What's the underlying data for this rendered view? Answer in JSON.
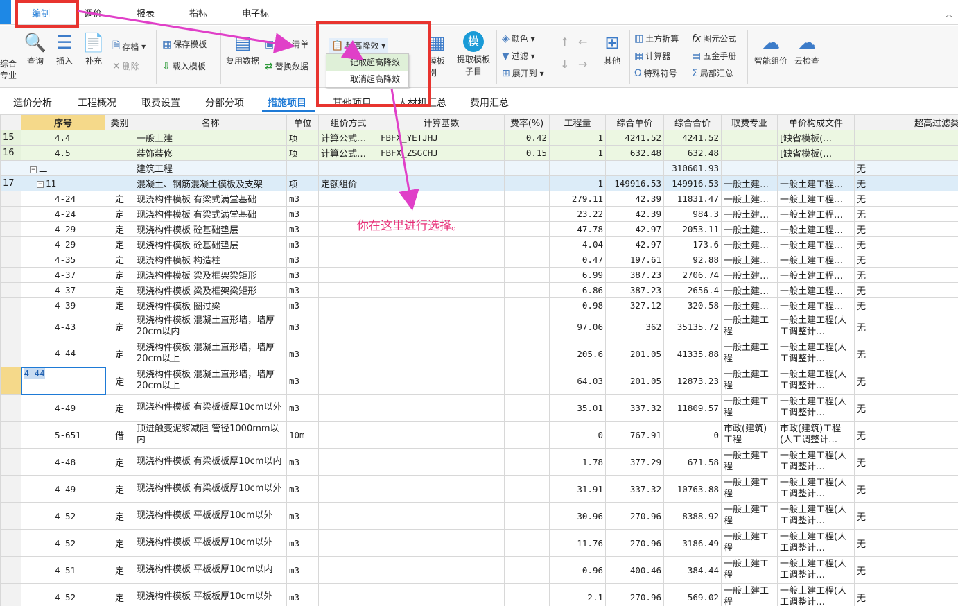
{
  "menu": {
    "items": [
      "编制",
      "调价",
      "报表",
      "指标",
      "电子标"
    ]
  },
  "ribbon": {
    "left_clip_top": "综合",
    "left_clip_bottom": "专业",
    "query": "查询",
    "insert": "插入",
    "supplement": "补充",
    "save": "存档",
    "delete": "删除",
    "save_template": "保存模板",
    "load_template": "载入模板",
    "reuse_data": "复用数据",
    "bill": "清单",
    "replace_data": "替换数据",
    "super_high": "超高降效",
    "template_clip": "模板",
    "template_clip2": "别",
    "extract_template": "提取模板",
    "extract_template2": "子目",
    "template_icon_char": "模",
    "color": "颜色",
    "filter": "过滤",
    "expand": "展开到",
    "other": "其他",
    "earthwork": "土方折算",
    "calculator": "计算器",
    "special_symbol": "特殊符号",
    "element_formula": "图元公式",
    "hardware_manual": "五金手册",
    "partial_summary": "局部汇总",
    "smart_pricing": "智能组价",
    "cloud_check": "云检查"
  },
  "dropdown": {
    "items": [
      "记取超高降效",
      "取消超高降效"
    ]
  },
  "tabs": [
    "造价分析",
    "工程概况",
    "取费设置",
    "分部分项",
    "措施项目",
    "其他项目",
    "人材机汇总",
    "费用汇总"
  ],
  "columns": [
    "序号",
    "类别",
    "名称",
    "单位",
    "组价方式",
    "计算基数",
    "费率(%)",
    "工程量",
    "综合单价",
    "综合合价",
    "取费专业",
    "单价构成文件",
    "超高过滤类别"
  ],
  "rows": [
    {
      "rn": "15",
      "seq": "4.4",
      "type": "",
      "name": "一般土建",
      "unit": "项",
      "method": "计算公式…",
      "base": "FBFX_YETJHJ",
      "rate": "0.42",
      "qty": "1",
      "price": "4241.52",
      "total": "4241.52",
      "major": "",
      "file": "[缺省模板(…",
      "filter": ""
    },
    {
      "rn": "16",
      "seq": "4.5",
      "type": "",
      "name": "装饰装修",
      "unit": "项",
      "method": "计算公式…",
      "base": "FBFX_ZSGCHJ",
      "rate": "0.15",
      "qty": "1",
      "price": "632.48",
      "total": "632.48",
      "major": "",
      "file": "[缺省模板(…",
      "filter": ""
    },
    {
      "rn": "",
      "seq": "二",
      "type": "",
      "name": "建筑工程",
      "unit": "",
      "method": "",
      "base": "",
      "rate": "",
      "qty": "",
      "price": "",
      "total": "310601.93",
      "major": "",
      "file": "",
      "filter": "无"
    },
    {
      "rn": "17",
      "seq": "11",
      "type": "",
      "name": "混凝土、钢筋混凝土模板及支架",
      "unit": "项",
      "method": "定额组价",
      "base": "",
      "rate": "",
      "qty": "1",
      "price": "149916.53",
      "total": "149916.53",
      "major": "一般土建…",
      "file": "一般土建工程…",
      "filter": "无"
    },
    {
      "rn": "",
      "seq": "4-24",
      "type": "定",
      "name": "现浇构件模板 有梁式满堂基础",
      "unit": "m3",
      "qty": "279.11",
      "price": "42.39",
      "total": "11831.47",
      "major": "一般土建…",
      "file": "一般土建工程…",
      "filter": "无"
    },
    {
      "rn": "",
      "seq": "4-24",
      "type": "定",
      "name": "现浇构件模板 有梁式满堂基础",
      "unit": "m3",
      "qty": "23.22",
      "price": "42.39",
      "total": "984.3",
      "major": "一般土建…",
      "file": "一般土建工程…",
      "filter": "无"
    },
    {
      "rn": "",
      "seq": "4-29",
      "type": "定",
      "name": "现浇构件模板 砼基础垫层",
      "unit": "m3",
      "qty": "47.78",
      "price": "42.97",
      "total": "2053.11",
      "major": "一般土建…",
      "file": "一般土建工程…",
      "filter": "无"
    },
    {
      "rn": "",
      "seq": "4-29",
      "type": "定",
      "name": "现浇构件模板 砼基础垫层",
      "unit": "m3",
      "qty": "4.04",
      "price": "42.97",
      "total": "173.6",
      "major": "一般土建…",
      "file": "一般土建工程…",
      "filter": "无"
    },
    {
      "rn": "",
      "seq": "4-35",
      "type": "定",
      "name": "现浇构件模板 构造柱",
      "unit": "m3",
      "qty": "0.47",
      "price": "197.61",
      "total": "92.88",
      "major": "一般土建…",
      "file": "一般土建工程…",
      "filter": "无"
    },
    {
      "rn": "",
      "seq": "4-37",
      "type": "定",
      "name": "现浇构件模板 梁及框架梁矩形",
      "unit": "m3",
      "qty": "6.99",
      "price": "387.23",
      "total": "2706.74",
      "major": "一般土建…",
      "file": "一般土建工程…",
      "filter": "无"
    },
    {
      "rn": "",
      "seq": "4-37",
      "type": "定",
      "name": "现浇构件模板 梁及框架梁矩形",
      "unit": "m3",
      "qty": "6.86",
      "price": "387.23",
      "total": "2656.4",
      "major": "一般土建…",
      "file": "一般土建工程…",
      "filter": "无"
    },
    {
      "rn": "",
      "seq": "4-39",
      "type": "定",
      "name": "现浇构件模板 圈过梁",
      "unit": "m3",
      "qty": "0.98",
      "price": "327.12",
      "total": "320.58",
      "major": "一般土建…",
      "file": "一般土建工程…",
      "filter": "无"
    },
    {
      "rn": "",
      "seq": "4-43",
      "type": "定",
      "name": "现浇构件模板 混凝土直形墙，墙厚20cm以内",
      "unit": "m3",
      "qty": "97.06",
      "price": "362",
      "total": "35135.72",
      "major": "一般土建工程",
      "file": "一般土建工程(人工调整计…",
      "filter": "无",
      "tall": true
    },
    {
      "rn": "",
      "seq": "4-44",
      "type": "定",
      "name": "现浇构件模板 混凝土直形墙，墙厚20cm以上",
      "unit": "m3",
      "qty": "205.6",
      "price": "201.05",
      "total": "41335.88",
      "major": "一般土建工程",
      "file": "一般土建工程(人工调整计…",
      "filter": "无",
      "tall": true
    },
    {
      "rn": "",
      "seq": "4-44",
      "type": "定",
      "name": "现浇构件模板 混凝土直形墙，墙厚20cm以上",
      "unit": "m3",
      "qty": "64.03",
      "price": "201.05",
      "total": "12873.23",
      "major": "一般土建工程",
      "file": "一般土建工程(人工调整计…",
      "filter": "无",
      "tall": true,
      "selected": true
    },
    {
      "rn": "",
      "seq": "4-49",
      "type": "定",
      "name": "现浇构件模板 有梁板板厚10cm以外",
      "unit": "m3",
      "qty": "35.01",
      "price": "337.32",
      "total": "11809.57",
      "major": "一般土建工程",
      "file": "一般土建工程(人工调整计…",
      "filter": "无",
      "tall": true
    },
    {
      "rn": "",
      "seq": "5-651",
      "type": "借",
      "name": "顶进触变泥浆减阻 管径1000mm以内",
      "unit": "10m",
      "qty": "0",
      "price": "767.91",
      "total": "0",
      "major": "市政(建筑)工程",
      "file": "市政(建筑)工程(人工调整计…",
      "filter": "无",
      "tall": true
    },
    {
      "rn": "",
      "seq": "4-48",
      "type": "定",
      "name": "现浇构件模板 有梁板板厚10cm以内",
      "unit": "m3",
      "qty": "1.78",
      "price": "377.29",
      "total": "671.58",
      "major": "一般土建工程",
      "file": "一般土建工程(人工调整计…",
      "filter": "无",
      "tall": true
    },
    {
      "rn": "",
      "seq": "4-49",
      "type": "定",
      "name": "现浇构件模板 有梁板板厚10cm以外",
      "unit": "m3",
      "qty": "31.91",
      "price": "337.32",
      "total": "10763.88",
      "major": "一般土建工程",
      "file": "一般土建工程(人工调整计…",
      "filter": "无",
      "tall": true
    },
    {
      "rn": "",
      "seq": "4-52",
      "type": "定",
      "name": "现浇构件模板 平板板厚10cm以外",
      "unit": "m3",
      "qty": "30.96",
      "price": "270.96",
      "total": "8388.92",
      "major": "一般土建工程",
      "file": "一般土建工程(人工调整计…",
      "filter": "无",
      "tall": true
    },
    {
      "rn": "",
      "seq": "4-52",
      "type": "定",
      "name": "现浇构件模板 平板板厚10cm以外",
      "unit": "m3",
      "qty": "11.76",
      "price": "270.96",
      "total": "3186.49",
      "major": "一般土建工程",
      "file": "一般土建工程(人工调整计…",
      "filter": "无",
      "tall": true
    },
    {
      "rn": "",
      "seq": "4-51",
      "type": "定",
      "name": "现浇构件模板 平板板厚10cm以内",
      "unit": "m3",
      "qty": "0.96",
      "price": "400.46",
      "total": "384.44",
      "major": "一般土建工程",
      "file": "一般土建工程(人工调整计…",
      "filter": "无",
      "tall": true
    },
    {
      "rn": "",
      "seq": "4-52",
      "type": "定",
      "name": "现浇构件模板 平板板厚10cm以外",
      "unit": "m3",
      "qty": "2.1",
      "price": "270.96",
      "total": "569.02",
      "major": "一般土建工程",
      "file": "一般土建工程(人工调整计…",
      "filter": "无",
      "tall": true
    }
  ],
  "annotation": {
    "text": "你在这里进行选择。"
  },
  "colors": {
    "accent": "#1e7ad6",
    "highlight_box": "#e8342f",
    "arrow": "#e040c8",
    "group_row": "#ecf7e2"
  }
}
